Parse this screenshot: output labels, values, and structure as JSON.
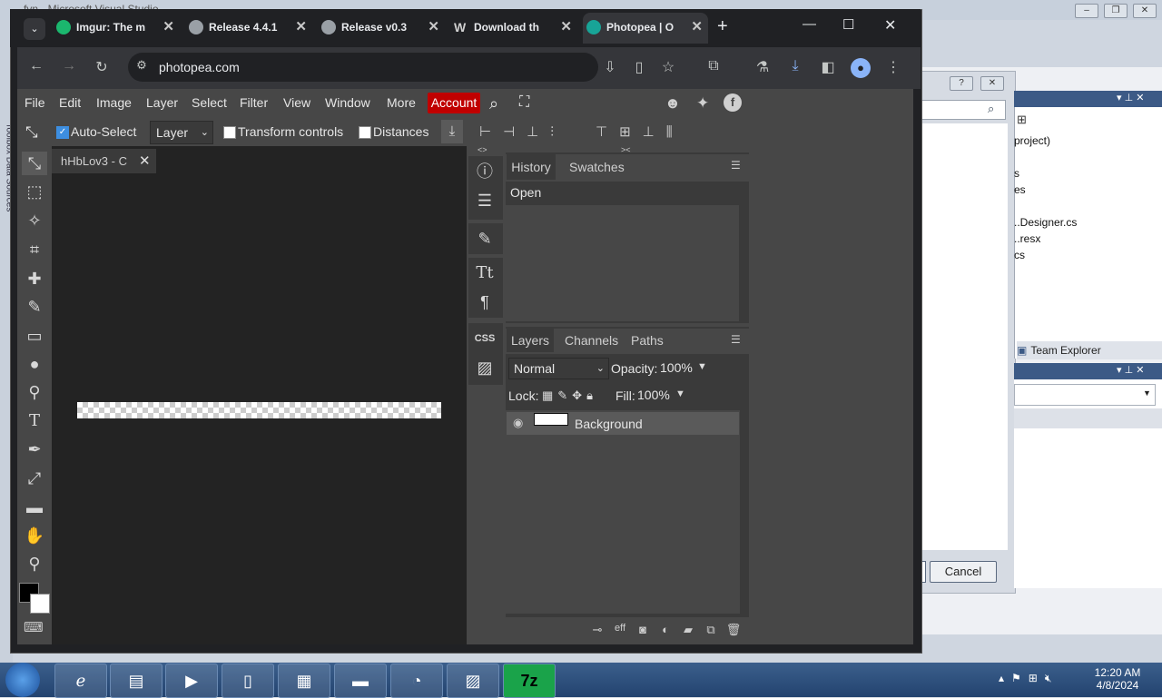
{
  "vs": {
    "title": "fvn - Microsoft Visual Studio",
    "solution_items": [
      "project)",
      "s",
      "es",
      "..Designer.cs",
      "..resx",
      "cs"
    ],
    "team_explorer": "Team Explorer",
    "cancel": "Cancel",
    "side_text": "Toolbox  Data Sources"
  },
  "chrome": {
    "tabs": [
      {
        "label": "Imgur: The m",
        "color": "#1bb76e"
      },
      {
        "label": "Release 4.4.1",
        "color": "#9aa0a6"
      },
      {
        "label": "Release v0.3",
        "color": "#9aa0a6"
      },
      {
        "label": "Download th",
        "color": "#9aa0a6"
      },
      {
        "label": "Photopea | O",
        "color": "#18a497"
      }
    ],
    "url": "photopea.com"
  },
  "photopea": {
    "menu": [
      "File",
      "Edit",
      "Image",
      "Layer",
      "Select",
      "Filter",
      "View",
      "Window",
      "More"
    ],
    "account": "Account",
    "options": {
      "auto_select": "Auto-Select",
      "layer_mode": "Layer",
      "transform_controls": "Transform controls",
      "distances": "Distances"
    },
    "doc_tab": "hHbLov3 - C",
    "history": {
      "tabs": [
        "History",
        "Swatches"
      ],
      "items": [
        "Open"
      ]
    },
    "layers": {
      "tabs": [
        "Layers",
        "Channels",
        "Paths"
      ],
      "blend_mode": "Normal",
      "opacity_label": "Opacity:",
      "opacity": "100%",
      "lock_label": "Lock:",
      "fill_label": "Fill:",
      "fill": "100%",
      "items": [
        {
          "name": "Background"
        }
      ]
    },
    "side_css": "CSS"
  },
  "taskbar": {
    "time": "12:20 AM",
    "date": "4/8/2024",
    "sevenzip": "7z"
  }
}
